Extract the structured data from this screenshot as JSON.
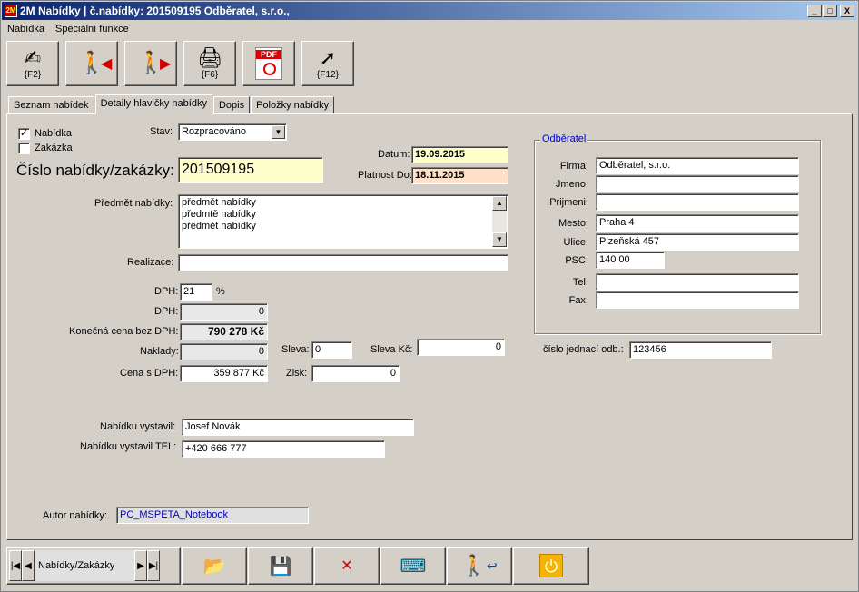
{
  "window": {
    "title": "2M Nabídky | č.nabídky: 201509195  Odběratel, s.r.o.,",
    "minimize": "_",
    "maximize": "□",
    "close": "X"
  },
  "menu": [
    "Nabídka",
    "Speciální funkce"
  ],
  "toolbar": [
    {
      "icon": "signature-icon",
      "glyph": "✍",
      "key": "{F2}"
    },
    {
      "icon": "person-prev-icon",
      "glyph": "◀",
      "key": ""
    },
    {
      "icon": "person-next-icon",
      "glyph": "▶",
      "key": ""
    },
    {
      "icon": "printer-icon",
      "glyph": "🖨",
      "key": "{F6}"
    },
    {
      "icon": "pdf-icon",
      "glyph": "PDF",
      "key": ""
    },
    {
      "icon": "export-icon",
      "glyph": "➚",
      "key": "{F12}"
    }
  ],
  "tabs": [
    "Seznam nabídek",
    "Detaily hlavičky nabídky",
    "Dopis",
    "Položky nabídky"
  ],
  "form": {
    "chk_nabidka_label": "Nabídka",
    "chk_nabidka_mark": "✓",
    "chk_zakazka_label": "Zakázka",
    "stav_label": "Stav:",
    "stav_value": "Rozpracováno",
    "datum_label": "Datum:",
    "datum_value": "19.09.2015",
    "platnost_label": "Platnost Do:",
    "platnost_value": "18.11.2015",
    "cislo_label": "Číslo nabídky/zakázky:",
    "cislo_value": "201509195",
    "predmet_label": "Předmět nabídky:",
    "predmet_lines": [
      "předmět nabídky",
      "předmtě nabídky",
      "předmět nabídky"
    ],
    "realizace_label": "Realizace:",
    "realizace_value": "",
    "dph_pct_label": "DPH:",
    "dph_pct_value": "21",
    "dph_pct_unit": "%",
    "dph_label": "DPH:",
    "dph_value": "0",
    "konecna_label": "Konečná cena bez DPH:",
    "konecna_value": "790 278 Kč",
    "naklady_label": "Naklady:",
    "naklady_value": "0",
    "cena_dph_label": "Cena s DPH:",
    "cena_dph_value": "359 877 Kč",
    "sleva_label": "Sleva:",
    "sleva_value": "0",
    "sleva_kc_label": "Sleva Kč:",
    "sleva_kc_value": "0",
    "zisk_label": "Zisk:",
    "zisk_value": "0",
    "vystavil_label": "Nabídku vystavil:",
    "vystavil_value": "Josef Novák",
    "vystavil_tel_label": "Nabídku vystavil TEL:",
    "vystavil_tel_value": "+420 666 777",
    "autor_label": "Autor nabídky:",
    "autor_value": "PC_MSPETA_Notebook"
  },
  "odberatel": {
    "title": "Odběratel",
    "firma_label": "Firma:",
    "firma_value": "Odběratel, s.r.o.",
    "jmeno_label": "Jmeno:",
    "jmeno_value": "",
    "prijmeni_label": "Prijmeni:",
    "prijmeni_value": "",
    "mesto_label": "Mesto:",
    "mesto_value": "Praha 4",
    "ulice_label": "Ulice:",
    "ulice_value": "Plzeňská 457",
    "psc_label": "PSC:",
    "psc_value": "140 00",
    "tel_label": "Tel:",
    "tel_value": "",
    "fax_label": "Fax:",
    "fax_value": "",
    "cj_label": "číslo jednací odb.:",
    "cj_value": "123456"
  },
  "navigator": {
    "label": "Nabídky/Zakázky",
    "first": "|◀",
    "prev": "◀",
    "next": "▶",
    "last": "▶|"
  },
  "bottom_buttons": [
    {
      "icon": "open-folder-icon",
      "glyph": "📂"
    },
    {
      "icon": "save-disk-icon",
      "glyph": "💾"
    },
    {
      "icon": "cancel-x-icon",
      "glyph": "✕"
    },
    {
      "icon": "keyboard-icon",
      "glyph": "⌨"
    },
    {
      "icon": "person-exit-icon",
      "glyph": "↩"
    },
    {
      "icon": "power-icon",
      "glyph": "⏻"
    }
  ],
  "colors": {
    "datum_bg": "#ffffcc",
    "platnost_bg": "#ffe0c8",
    "cislo_bg": "#ffffcc",
    "accent_red": "#d00000",
    "power_bg": "#f5b400"
  }
}
